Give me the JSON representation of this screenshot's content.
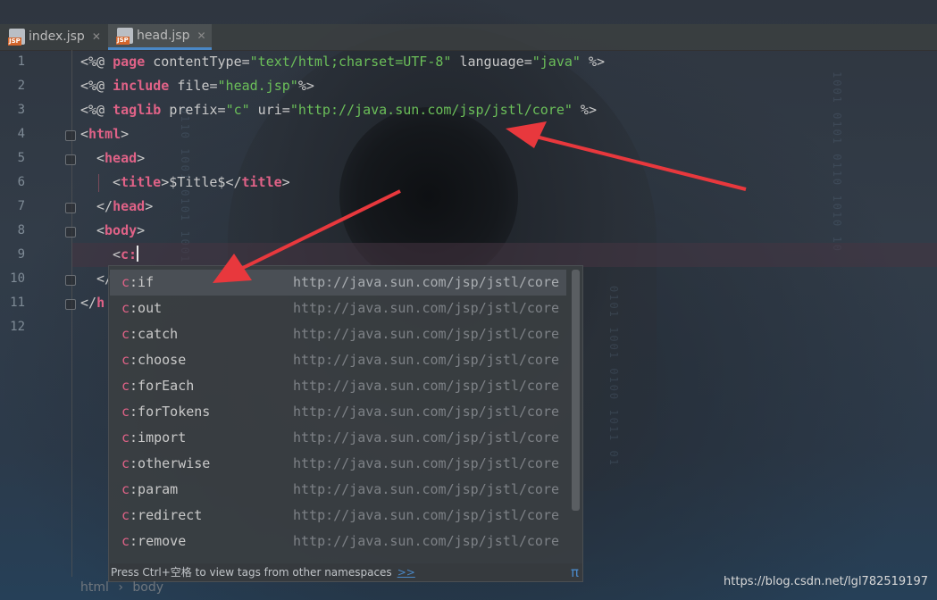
{
  "tabs": [
    {
      "label": "index.jsp",
      "icon": "jsp-file-icon",
      "badge": "JSP",
      "active": false
    },
    {
      "label": "head.jsp",
      "icon": "jsp-file-icon",
      "badge": "JSP",
      "active": true
    }
  ],
  "editor": {
    "line_numbers": [
      "1",
      "2",
      "3",
      "4",
      "5",
      "6",
      "7",
      "8",
      "9",
      "10",
      "11",
      "12"
    ],
    "lines": {
      "l1": {
        "a": "<%@ ",
        "kw": "page",
        "b": " contentType=",
        "s1": "\"text/html;charset=UTF-8\"",
        "c": " language=",
        "s2": "\"java\"",
        "d": " %>"
      },
      "l2": {
        "a": "<%@ ",
        "kw": "include",
        "b": " file=",
        "s1": "\"head.jsp\"",
        "d": "%>"
      },
      "l3": {
        "a": "<%@ ",
        "kw": "taglib",
        "b": " prefix=",
        "s1": "\"c\"",
        "c": " uri=",
        "s2": "\"http://java.sun.com/jsp/jstl/core\"",
        "d": " %>"
      },
      "l4": {
        "open": "<",
        "tag": "html",
        "close": ">"
      },
      "l5": {
        "open": "<",
        "tag": "head",
        "close": ">"
      },
      "l6": {
        "open": "<",
        "tag": "title",
        "close": ">",
        "text": "$Title$",
        "open2": "</",
        "tag2": "title",
        "close2": ">"
      },
      "l7": {
        "open": "</",
        "tag": "head",
        "close": ">"
      },
      "l8": {
        "open": "<",
        "tag": "body",
        "close": ">"
      },
      "l9": {
        "open": "<",
        "tag": "c:"
      },
      "l10": {
        "text": "</"
      },
      "l11": {
        "open": "</",
        "tag": "h"
      }
    }
  },
  "completion": {
    "items": [
      {
        "prefix": "c",
        "rest": ":if",
        "uri": "http://java.sun.com/jsp/jstl/core",
        "selected": true
      },
      {
        "prefix": "c",
        "rest": ":out",
        "uri": "http://java.sun.com/jsp/jstl/core"
      },
      {
        "prefix": "c",
        "rest": ":catch",
        "uri": "http://java.sun.com/jsp/jstl/core"
      },
      {
        "prefix": "c",
        "rest": ":choose",
        "uri": "http://java.sun.com/jsp/jstl/core"
      },
      {
        "prefix": "c",
        "rest": ":forEach",
        "uri": "http://java.sun.com/jsp/jstl/core"
      },
      {
        "prefix": "c",
        "rest": ":forTokens",
        "uri": "http://java.sun.com/jsp/jstl/core"
      },
      {
        "prefix": "c",
        "rest": ":import",
        "uri": "http://java.sun.com/jsp/jstl/core"
      },
      {
        "prefix": "c",
        "rest": ":otherwise",
        "uri": "http://java.sun.com/jsp/jstl/core"
      },
      {
        "prefix": "c",
        "rest": ":param",
        "uri": "http://java.sun.com/jsp/jstl/core"
      },
      {
        "prefix": "c",
        "rest": ":redirect",
        "uri": "http://java.sun.com/jsp/jstl/core"
      },
      {
        "prefix": "c",
        "rest": ":remove",
        "uri": "http://java.sun.com/jsp/jstl/core"
      }
    ],
    "hint": "Press Ctrl+空格 to view tags from other namespaces",
    "more_link": ">>",
    "pi_symbol": "π"
  },
  "breadcrumb": {
    "items": [
      "html",
      "body"
    ],
    "separator": "›"
  },
  "watermark": "https://blog.csdn.net/lgl782519197",
  "colors": {
    "keyword": "#e06287",
    "string": "#6bbf59",
    "accent": "#4a88c7",
    "arrow": "#e8383d"
  }
}
